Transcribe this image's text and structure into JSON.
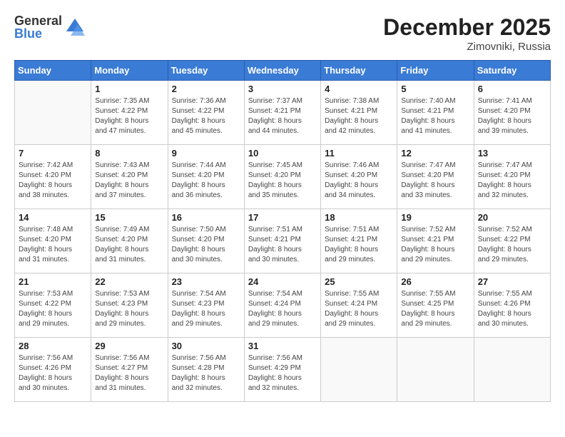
{
  "header": {
    "logo_general": "General",
    "logo_blue": "Blue",
    "month_title": "December 2025",
    "location": "Zimovniki, Russia"
  },
  "weekdays": [
    "Sunday",
    "Monday",
    "Tuesday",
    "Wednesday",
    "Thursday",
    "Friday",
    "Saturday"
  ],
  "weeks": [
    [
      {
        "day": "",
        "info": ""
      },
      {
        "day": "1",
        "info": "Sunrise: 7:35 AM\nSunset: 4:22 PM\nDaylight: 8 hours\nand 47 minutes."
      },
      {
        "day": "2",
        "info": "Sunrise: 7:36 AM\nSunset: 4:22 PM\nDaylight: 8 hours\nand 45 minutes."
      },
      {
        "day": "3",
        "info": "Sunrise: 7:37 AM\nSunset: 4:21 PM\nDaylight: 8 hours\nand 44 minutes."
      },
      {
        "day": "4",
        "info": "Sunrise: 7:38 AM\nSunset: 4:21 PM\nDaylight: 8 hours\nand 42 minutes."
      },
      {
        "day": "5",
        "info": "Sunrise: 7:40 AM\nSunset: 4:21 PM\nDaylight: 8 hours\nand 41 minutes."
      },
      {
        "day": "6",
        "info": "Sunrise: 7:41 AM\nSunset: 4:20 PM\nDaylight: 8 hours\nand 39 minutes."
      }
    ],
    [
      {
        "day": "7",
        "info": "Sunrise: 7:42 AM\nSunset: 4:20 PM\nDaylight: 8 hours\nand 38 minutes."
      },
      {
        "day": "8",
        "info": "Sunrise: 7:43 AM\nSunset: 4:20 PM\nDaylight: 8 hours\nand 37 minutes."
      },
      {
        "day": "9",
        "info": "Sunrise: 7:44 AM\nSunset: 4:20 PM\nDaylight: 8 hours\nand 36 minutes."
      },
      {
        "day": "10",
        "info": "Sunrise: 7:45 AM\nSunset: 4:20 PM\nDaylight: 8 hours\nand 35 minutes."
      },
      {
        "day": "11",
        "info": "Sunrise: 7:46 AM\nSunset: 4:20 PM\nDaylight: 8 hours\nand 34 minutes."
      },
      {
        "day": "12",
        "info": "Sunrise: 7:47 AM\nSunset: 4:20 PM\nDaylight: 8 hours\nand 33 minutes."
      },
      {
        "day": "13",
        "info": "Sunrise: 7:47 AM\nSunset: 4:20 PM\nDaylight: 8 hours\nand 32 minutes."
      }
    ],
    [
      {
        "day": "14",
        "info": "Sunrise: 7:48 AM\nSunset: 4:20 PM\nDaylight: 8 hours\nand 31 minutes."
      },
      {
        "day": "15",
        "info": "Sunrise: 7:49 AM\nSunset: 4:20 PM\nDaylight: 8 hours\nand 31 minutes."
      },
      {
        "day": "16",
        "info": "Sunrise: 7:50 AM\nSunset: 4:20 PM\nDaylight: 8 hours\nand 30 minutes."
      },
      {
        "day": "17",
        "info": "Sunrise: 7:51 AM\nSunset: 4:21 PM\nDaylight: 8 hours\nand 30 minutes."
      },
      {
        "day": "18",
        "info": "Sunrise: 7:51 AM\nSunset: 4:21 PM\nDaylight: 8 hours\nand 29 minutes."
      },
      {
        "day": "19",
        "info": "Sunrise: 7:52 AM\nSunset: 4:21 PM\nDaylight: 8 hours\nand 29 minutes."
      },
      {
        "day": "20",
        "info": "Sunrise: 7:52 AM\nSunset: 4:22 PM\nDaylight: 8 hours\nand 29 minutes."
      }
    ],
    [
      {
        "day": "21",
        "info": "Sunrise: 7:53 AM\nSunset: 4:22 PM\nDaylight: 8 hours\nand 29 minutes."
      },
      {
        "day": "22",
        "info": "Sunrise: 7:53 AM\nSunset: 4:23 PM\nDaylight: 8 hours\nand 29 minutes."
      },
      {
        "day": "23",
        "info": "Sunrise: 7:54 AM\nSunset: 4:23 PM\nDaylight: 8 hours\nand 29 minutes."
      },
      {
        "day": "24",
        "info": "Sunrise: 7:54 AM\nSunset: 4:24 PM\nDaylight: 8 hours\nand 29 minutes."
      },
      {
        "day": "25",
        "info": "Sunrise: 7:55 AM\nSunset: 4:24 PM\nDaylight: 8 hours\nand 29 minutes."
      },
      {
        "day": "26",
        "info": "Sunrise: 7:55 AM\nSunset: 4:25 PM\nDaylight: 8 hours\nand 29 minutes."
      },
      {
        "day": "27",
        "info": "Sunrise: 7:55 AM\nSunset: 4:26 PM\nDaylight: 8 hours\nand 30 minutes."
      }
    ],
    [
      {
        "day": "28",
        "info": "Sunrise: 7:56 AM\nSunset: 4:26 PM\nDaylight: 8 hours\nand 30 minutes."
      },
      {
        "day": "29",
        "info": "Sunrise: 7:56 AM\nSunset: 4:27 PM\nDaylight: 8 hours\nand 31 minutes."
      },
      {
        "day": "30",
        "info": "Sunrise: 7:56 AM\nSunset: 4:28 PM\nDaylight: 8 hours\nand 32 minutes."
      },
      {
        "day": "31",
        "info": "Sunrise: 7:56 AM\nSunset: 4:29 PM\nDaylight: 8 hours\nand 32 minutes."
      },
      {
        "day": "",
        "info": ""
      },
      {
        "day": "",
        "info": ""
      },
      {
        "day": "",
        "info": ""
      }
    ]
  ]
}
